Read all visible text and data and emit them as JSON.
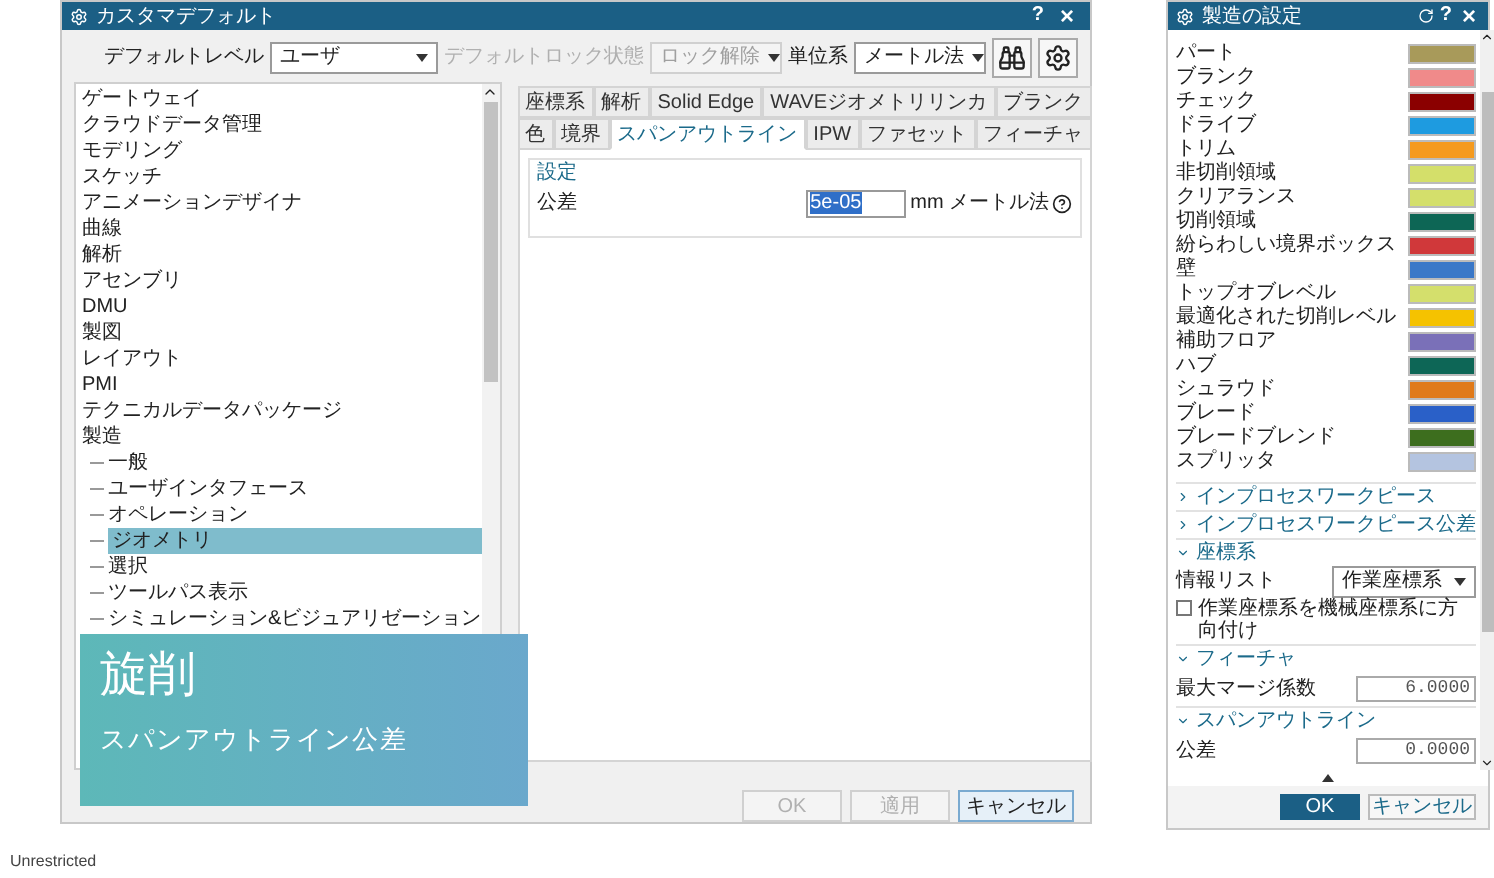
{
  "dialog": {
    "title": "カスタマデフォルト",
    "help": "?",
    "close": "×",
    "toolbar": {
      "default_level_label": "デフォルトレベル",
      "default_level": "ユーザ",
      "lock_label": "デフォルトロック状態",
      "lock_value": "ロック解除",
      "lock_disabled": true,
      "units_label": "単位系",
      "units": "メートル法"
    },
    "tree": [
      {
        "label": "ゲートウェイ",
        "selected": false
      },
      {
        "label": "クラウドデータ管理",
        "selected": false
      },
      {
        "label": "モデリング",
        "selected": false
      },
      {
        "label": "スケッチ",
        "selected": false
      },
      {
        "label": "アニメーションデザイナ",
        "selected": false
      },
      {
        "label": "曲線",
        "selected": false
      },
      {
        "label": "解析",
        "selected": false
      },
      {
        "label": "アセンブリ",
        "selected": false
      },
      {
        "label": "DMU",
        "selected": false
      },
      {
        "label": "製図",
        "selected": false
      },
      {
        "label": "レイアウト",
        "selected": false
      },
      {
        "label": "PMI",
        "selected": false
      },
      {
        "label": "テクニカルデータパッケージ",
        "selected": false
      },
      {
        "label": "製造",
        "selected": false,
        "children": [
          {
            "label": "一般",
            "selected": false
          },
          {
            "label": "ユーザインタフェース",
            "selected": false
          },
          {
            "label": "オペレーション",
            "selected": false
          },
          {
            "label": "ジオメトリ",
            "selected": true
          },
          {
            "label": "選択",
            "selected": false
          },
          {
            "label": "ツールパス表示",
            "selected": false
          },
          {
            "label": "シミュレーション&ビジュアリゼーション",
            "selected": false
          }
        ]
      }
    ],
    "tabs_row_1": [
      {
        "label": "座標系",
        "selected": false
      },
      {
        "label": "解析",
        "selected": false
      },
      {
        "label": "Solid Edge",
        "selected": false
      },
      {
        "label": "WAVEジオメトリリンカ",
        "selected": false
      },
      {
        "label": "ブランク",
        "selected": false
      }
    ],
    "tabs_row_2": [
      {
        "label": "色",
        "selected": false
      },
      {
        "label": "境界",
        "selected": false
      },
      {
        "label": "スパンアウトライン",
        "selected": true
      },
      {
        "label": "IPW",
        "selected": false
      },
      {
        "label": "ファセット",
        "selected": false
      },
      {
        "label": "フィーチャ",
        "selected": false
      }
    ],
    "panel": {
      "heading": "設定",
      "field_label": "公差",
      "value": "5e-05",
      "value_selected": true,
      "unit": "mm メートル法"
    },
    "buttons": [
      {
        "label": "OK",
        "disabled": true
      },
      {
        "label": "適用",
        "disabled": true
      },
      {
        "label": "キャンセル",
        "disabled": false
      }
    ]
  },
  "caption": {
    "title": "旋削",
    "subtitle": "スパンアウトライン公差"
  },
  "settings_panel": {
    "title": "製造の設定",
    "help": "?",
    "close": "×",
    "colors": [
      {
        "label": "パート",
        "color": "#a89a5a"
      },
      {
        "label": "ブランク",
        "color": "#f08a8a"
      },
      {
        "label": "チェック",
        "color": "#8b0000"
      },
      {
        "label": "ドライブ",
        "color": "#1e9be0"
      },
      {
        "label": "トリム",
        "color": "#f59a1e"
      },
      {
        "label": "非切削領域",
        "color": "#d4df6a"
      },
      {
        "label": "クリアランス",
        "color": "#d4df6b"
      },
      {
        "label": "切削領域",
        "color": "#0d6655"
      },
      {
        "label": "紛らわしい境界ボックス",
        "color": "#d0383a"
      },
      {
        "label": "壁",
        "color": "#3a78c8"
      },
      {
        "label": "トップオブレベル",
        "color": "#d4df6c"
      },
      {
        "label": "最適化された切削レベル",
        "color": "#f5c200"
      },
      {
        "label": "補助フロア",
        "color": "#7a70b8"
      },
      {
        "label": "ハブ",
        "color": "#0d6656"
      },
      {
        "label": "シュラウド",
        "color": "#e07a1a"
      },
      {
        "label": "ブレード",
        "color": "#2a60c8"
      },
      {
        "label": "ブレードブレンド",
        "color": "#3d6e1e"
      },
      {
        "label": "スプリッタ",
        "color": "#b4c4e0"
      }
    ],
    "sections": [
      {
        "label": "インプロセスワークピース",
        "expanded": false
      },
      {
        "label": "インプロセスワークピース公差",
        "expanded": false
      },
      {
        "label": "座標系",
        "expanded": true,
        "fields": [
          {
            "kind": "select",
            "label": "情報リスト",
            "value": "作業座標系"
          },
          {
            "kind": "checkbox",
            "label": "作業座標系を機械座標系に方向付け",
            "checked": false
          }
        ]
      },
      {
        "label": "フィーチャ",
        "expanded": true,
        "fields": [
          {
            "kind": "number",
            "label": "最大マージ係数",
            "value": "6.0000"
          }
        ]
      },
      {
        "label": "スパンアウトライン",
        "expanded": true,
        "fields": [
          {
            "kind": "number",
            "label": "公差",
            "value": "0.0000"
          }
        ]
      }
    ],
    "buttons": [
      {
        "label": "OK",
        "primary": true
      },
      {
        "label": "キャンセル",
        "primary": false
      }
    ]
  },
  "status_text": "Unrestricted"
}
